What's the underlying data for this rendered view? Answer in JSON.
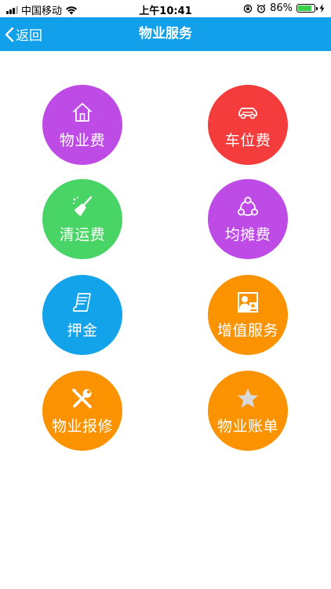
{
  "status_bar": {
    "carrier": "中国移动",
    "time": "上午10:41",
    "battery_percent": "86%",
    "battery_level": 0.86
  },
  "nav": {
    "back_label": "返回",
    "title": "物业服务",
    "color": "#11a0e9"
  },
  "services": [
    {
      "label": "物业费",
      "icon": "house-icon",
      "color": "#bf4be6"
    },
    {
      "label": "车位费",
      "icon": "car-icon",
      "color": "#f53c3c"
    },
    {
      "label": "清运费",
      "icon": "broom-icon",
      "color": "#49d466"
    },
    {
      "label": "均摊费",
      "icon": "share-icon",
      "color": "#bf4be6"
    },
    {
      "label": "押金",
      "icon": "receipt-icon",
      "color": "#12a3eb"
    },
    {
      "label": "增值服务",
      "icon": "add-person-icon",
      "color": "#fb9200"
    },
    {
      "label": "物业报修",
      "icon": "repair-tools-icon",
      "color": "#fb9200"
    },
    {
      "label": "物业账单",
      "icon": "star-icon",
      "color": "#fb9200"
    }
  ]
}
